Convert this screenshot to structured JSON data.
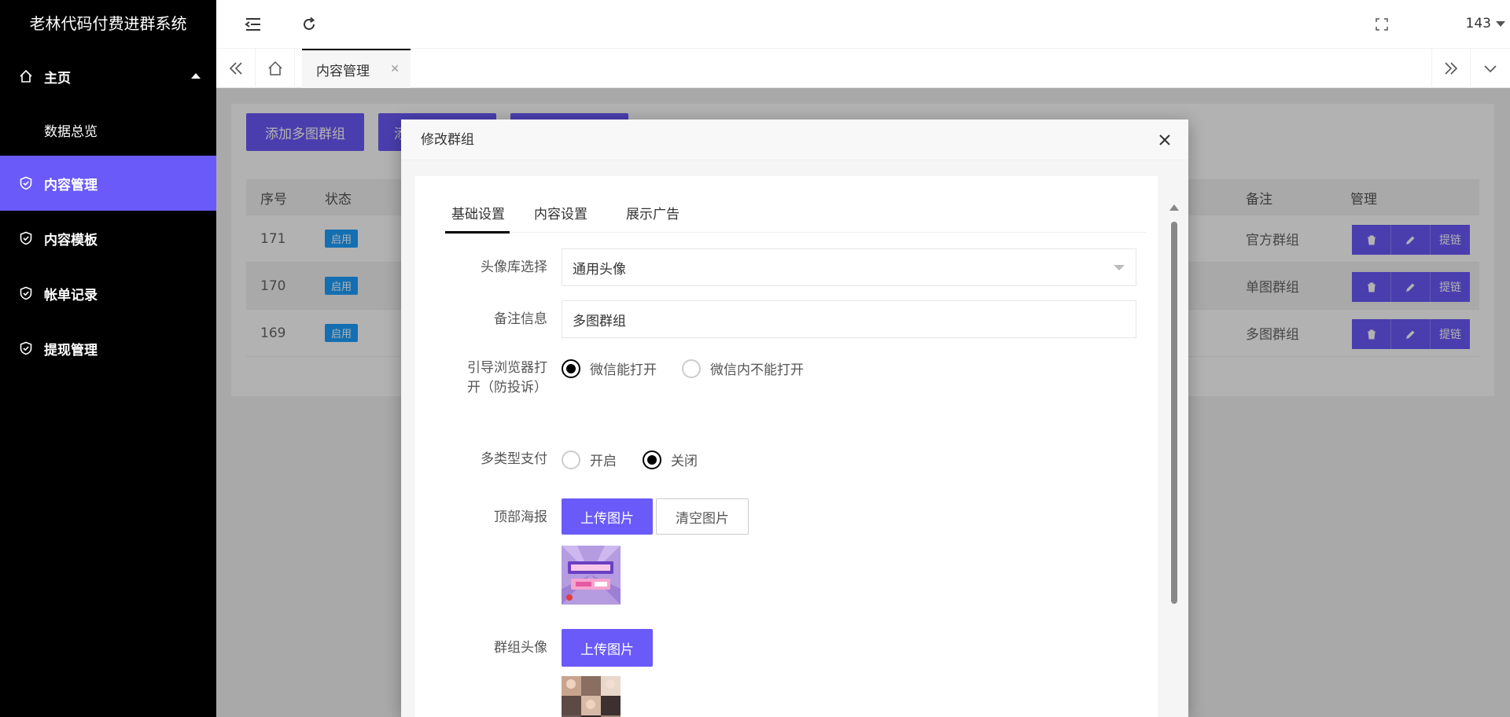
{
  "app": {
    "title": "老林代码付费进群系统"
  },
  "sidebar": {
    "items": [
      {
        "label": "主页",
        "icon": "home-icon"
      },
      {
        "label": "数据总览"
      },
      {
        "label": "内容管理",
        "icon": "shield-icon",
        "active": true
      },
      {
        "label": "内容模板",
        "icon": "shield-icon"
      },
      {
        "label": "帐单记录",
        "icon": "shield-icon"
      },
      {
        "label": "提现管理",
        "icon": "shield-icon"
      }
    ]
  },
  "header": {
    "user": "143"
  },
  "tabbar": {
    "tab_label": "内容管理",
    "close": "✕"
  },
  "page": {
    "buttons": [
      "添加多图群组",
      "添",
      ""
    ],
    "table": {
      "headers": [
        "序号",
        "状态",
        "备注",
        "管理"
      ],
      "rows": [
        {
          "id": "171",
          "status": "启用",
          "note": "官方群组"
        },
        {
          "id": "170",
          "status": "启用",
          "note": "单图群组"
        },
        {
          "id": "169",
          "status": "启用",
          "note": "多图群组"
        }
      ],
      "op_link": "提链"
    }
  },
  "modal": {
    "title": "修改群组",
    "tabs": [
      "基础设置",
      "内容设置",
      "展示广告"
    ],
    "fields": {
      "avatar_lib_label": "头像库选择",
      "avatar_lib_value": "通用头像",
      "note_label": "备注信息",
      "note_value": "多图群组",
      "guide_label": "引导浏览器打开（防投诉）",
      "guide_options": [
        "微信能打开",
        "微信内不能打开"
      ],
      "pay_label": "多类型支付",
      "pay_options": [
        "开启",
        "关闭"
      ],
      "poster_label": "顶部海报",
      "upload_label": "上传图片",
      "clear_label": "清空图片",
      "group_avatar_label": "群组头像"
    }
  },
  "colors": {
    "accent": "#6a5af9",
    "sidebar_bg": "#000000",
    "badge": "#1e9fff"
  }
}
